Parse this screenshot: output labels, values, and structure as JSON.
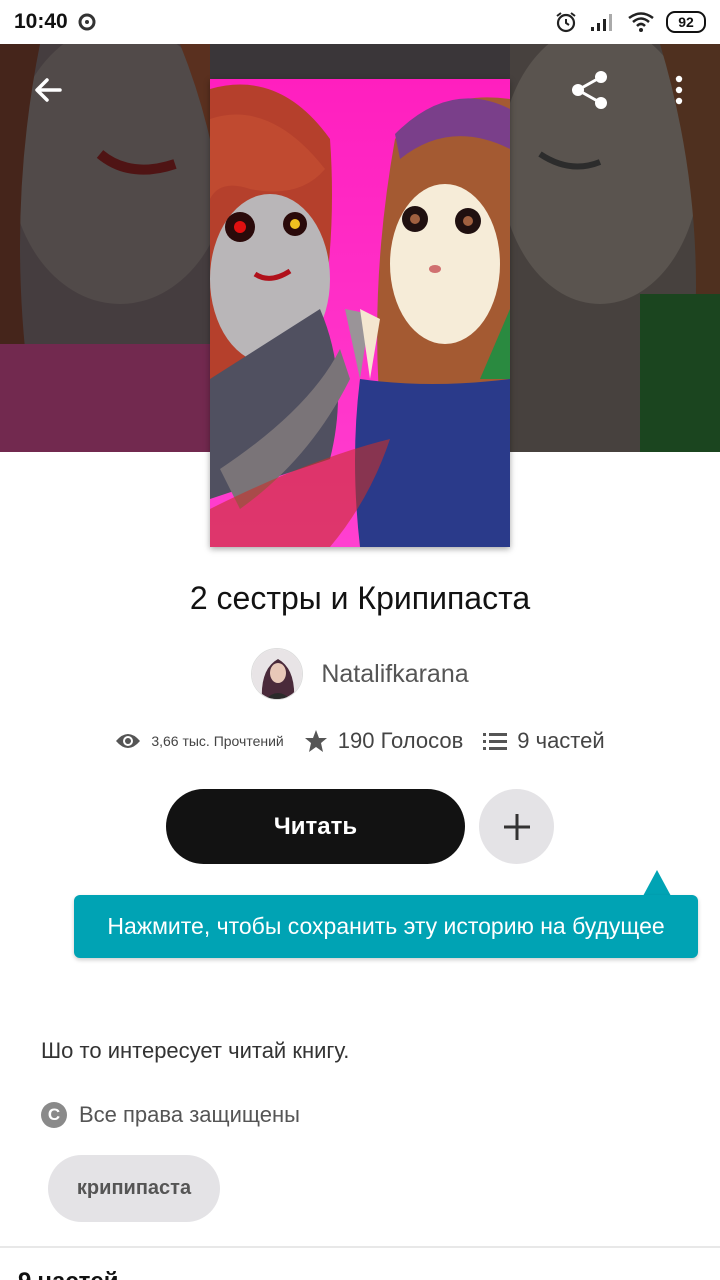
{
  "status_bar": {
    "time": "10:40",
    "battery": "92"
  },
  "story": {
    "title": "2 сестры  и Крипипаста",
    "author": "Natalifkarana",
    "stats": {
      "reads": "3,66 тыс. Прочтений",
      "votes": "190 Голосов",
      "parts": "9 частей"
    },
    "read_button": "Читать",
    "tooltip": "Нажмите, чтобы сохранить эту историю на будущее",
    "description": "Шо то интересует читай книгу.",
    "rights": "Все права защищены",
    "tag": "крипипаста",
    "parts_heading": "9 частей"
  },
  "colors": {
    "accent": "#00a3b4",
    "cover_bg": "#ff2fc8",
    "button_dark": "#121212"
  },
  "icons": [
    "back-arrow-icon",
    "share-icon",
    "more-vert-icon",
    "eye-icon",
    "star-icon",
    "list-icon",
    "plus-icon",
    "copyright-icon"
  ]
}
